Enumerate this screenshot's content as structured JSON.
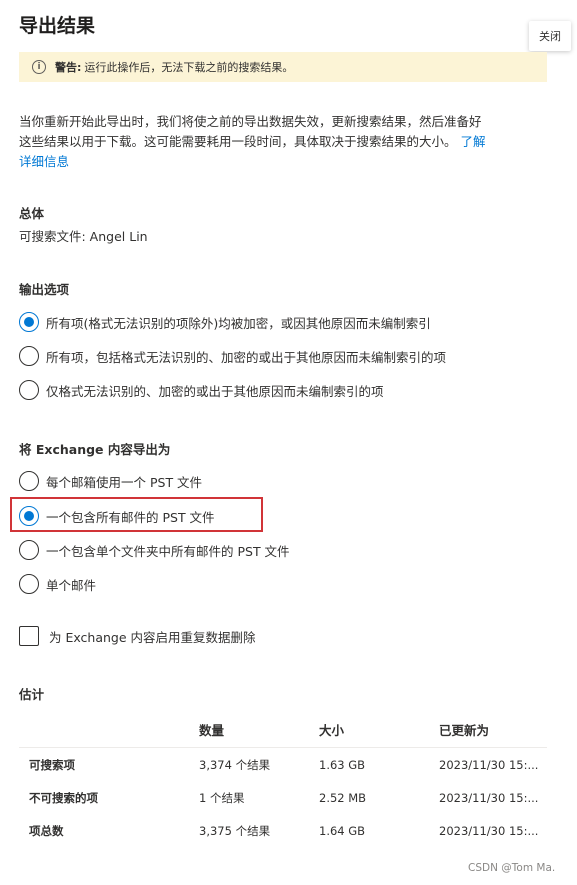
{
  "header": {
    "title": "导出结果",
    "close_label": "关闭"
  },
  "warning": {
    "label": "警告:",
    "text": "运行此操作后，无法下载之前的搜索结果。"
  },
  "description": {
    "line1": "当你重新开始此导出时，我们将使之前的导出数据失效，更新搜索结果，然后准备好",
    "line2": "这些结果以用于下载。这可能需要耗用一段时间，具体取决于搜索结果的大小。",
    "link1": "了解",
    "link2": "详细信息"
  },
  "overview": {
    "heading": "总体",
    "text": "可搜索文件: Angel Lin"
  },
  "output_options": {
    "heading": "输出选项",
    "options": [
      {
        "label": "所有项(格式无法识别的项除外)均被加密，或因其他原因而未编制索引",
        "checked": true
      },
      {
        "label": "所有项，包括格式无法识别的、加密的或出于其他原因而未编制索引的项",
        "checked": false
      },
      {
        "label": "仅格式无法识别的、加密的或出于其他原因而未编制索引的项",
        "checked": false
      }
    ]
  },
  "exchange_export": {
    "heading": "将 Exchange 内容导出为",
    "options": [
      {
        "label": "每个邮箱使用一个 PST 文件",
        "checked": false
      },
      {
        "label": "一个包含所有邮件的 PST 文件",
        "checked": true
      },
      {
        "label": "一个包含单个文件夹中所有邮件的 PST 文件",
        "checked": false
      },
      {
        "label": "单个邮件",
        "checked": false
      }
    ]
  },
  "dedup": {
    "label": "为 Exchange 内容启用重复数据删除",
    "checked": false
  },
  "estimate": {
    "heading": "估计",
    "columns": [
      "",
      "数量",
      "大小",
      "已更新为"
    ],
    "rows": [
      {
        "name": "可搜索项",
        "count": "3,374 个结果",
        "size": "1.63 GB",
        "updated": "2023/11/30 15:..."
      },
      {
        "name": "不可搜索的项",
        "count": "1 个结果",
        "size": "2.52 MB",
        "updated": "2023/11/30 15:..."
      },
      {
        "name": "项总数",
        "count": "3,375 个结果",
        "size": "1.64 GB",
        "updated": "2023/11/30 15:..."
      }
    ]
  },
  "watermark": "CSDN @Tom Ma.",
  "colors": {
    "accent": "#0078d4",
    "warning_bg": "#fcf4d6",
    "highlight": "#d13438"
  }
}
